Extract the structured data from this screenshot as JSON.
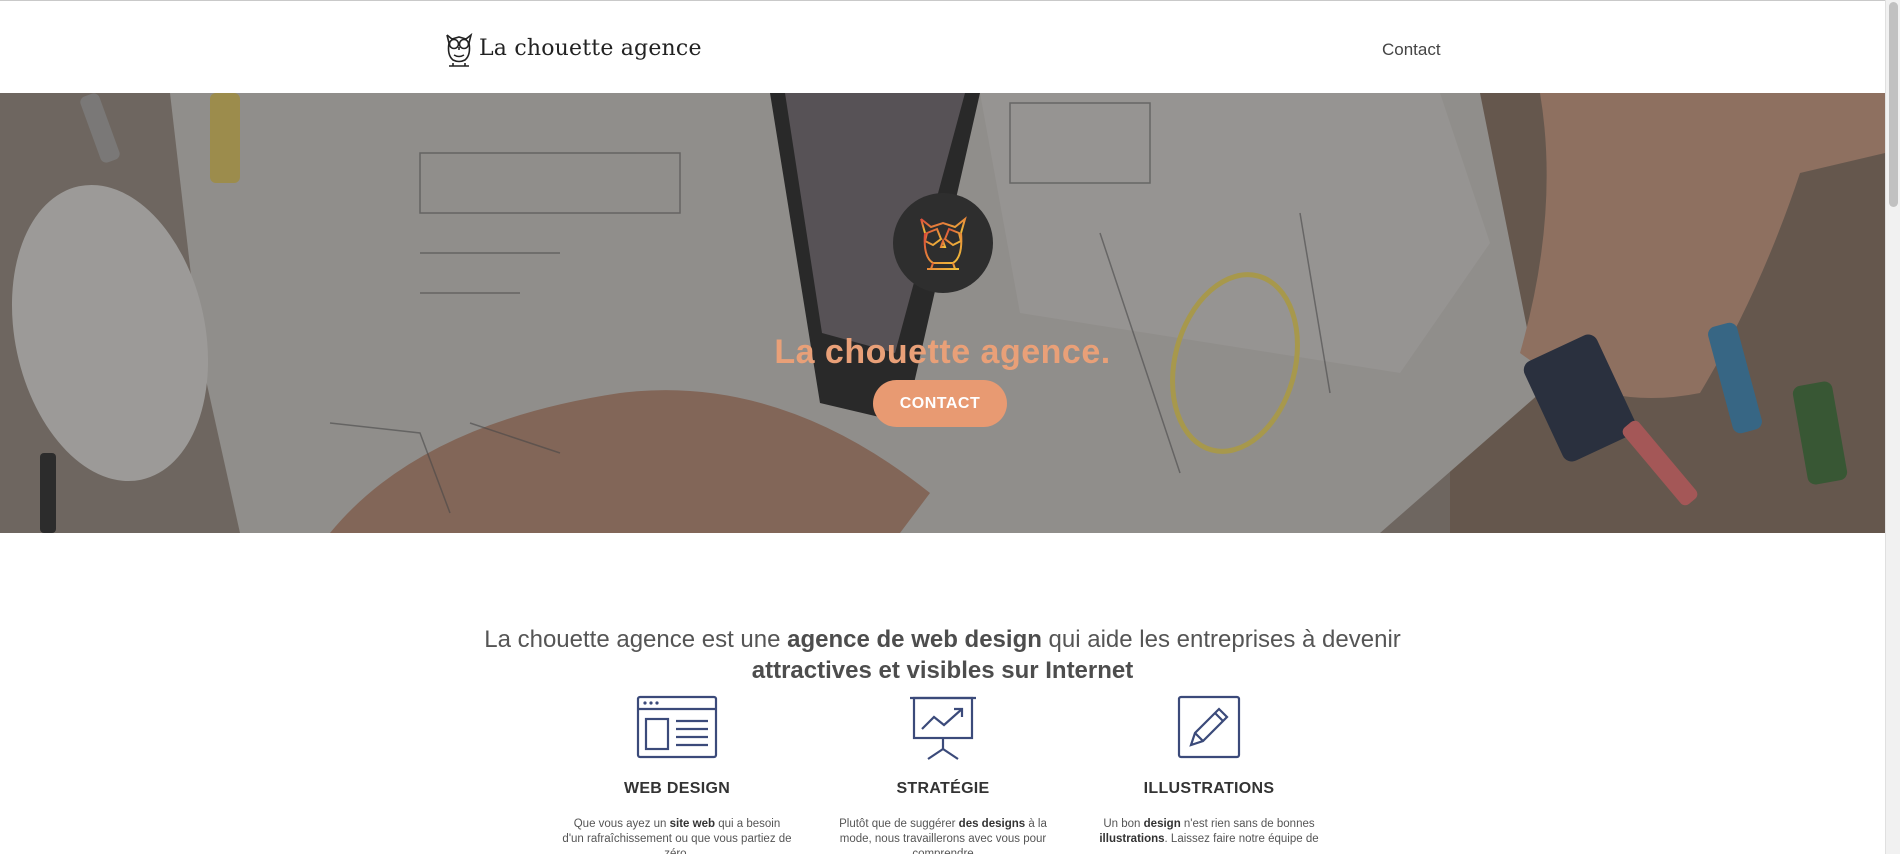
{
  "header": {
    "brand_name": "La chouette agence",
    "brand_icon": "owl-icon",
    "nav_contact": "Contact"
  },
  "hero": {
    "title": "La chouette agence.",
    "cta_label": "CONTACT",
    "badge_icon": "owl-icon",
    "title_color": "#e9a078",
    "cta_color": "#e89a72"
  },
  "intro": {
    "part1": "La chouette agence est une ",
    "bold1": "agence de web design",
    "part2": " qui aide les entreprises à devenir ",
    "bold2": "attractives et visibles sur Internet"
  },
  "services": [
    {
      "icon": "browser-window-icon",
      "title": "WEB DESIGN",
      "text1": "Que vous ayez un ",
      "bold1": "site web",
      "text2": " qui a besoin d'un rafraîchissement ou que vous partiez de zéro,"
    },
    {
      "icon": "presentation-chart-icon",
      "title": "STRATÉGIE",
      "text1": "Plutôt que de suggérer ",
      "bold1": "des designs",
      "text2": " à la mode, nous travaillerons avec vous pour comprendre"
    },
    {
      "icon": "pencil-frame-icon",
      "title": "ILLUSTRATIONS",
      "text1": "Un bon ",
      "bold1": "design",
      "text2": " n'est rien sans de bonnes ",
      "bold2": "illustrations",
      "text3": ". Laissez faire notre équipe de"
    }
  ],
  "colors": {
    "icon_navy": "#3b4a7a",
    "accent": "#e89a72"
  }
}
